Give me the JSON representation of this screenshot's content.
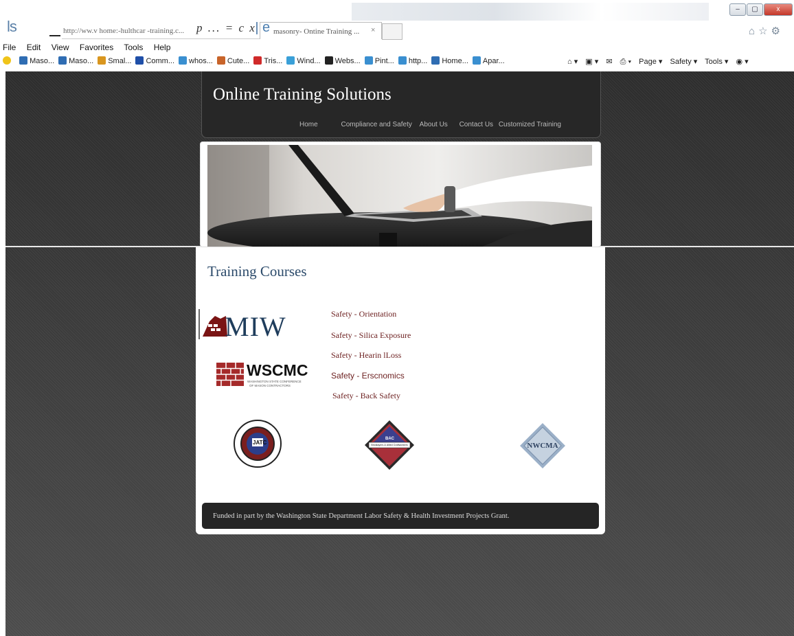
{
  "chrome": {
    "brand_letters": "ls",
    "url": "http://ww.v home:-hulthcar -training.c...",
    "address_controls": "p ... = c x",
    "tab_favicon_letter": "e",
    "tab_title": "masonry- Ontine Training ...",
    "tab_close": "×",
    "window_buttons": {
      "minimize": "–",
      "maximize": "▢",
      "close": "x"
    },
    "menu": [
      "File",
      "Edit",
      "View",
      "Favorites",
      "Tools",
      "Help"
    ],
    "favorites": [
      {
        "label": "Maso...",
        "icon": "blue-square-icon",
        "color": "#2f6db3"
      },
      {
        "label": "Maso...",
        "icon": "blue-square-icon",
        "color": "#2f6db3"
      },
      {
        "label": "Smal...",
        "icon": "leaf-icon",
        "color": "#d9961f"
      },
      {
        "label": "Comm...",
        "icon": "chart-icon",
        "color": "#1f4fa8"
      },
      {
        "label": "whos...",
        "icon": "ie-page-icon",
        "color": "#3a8fd0"
      },
      {
        "label": "Cute...",
        "icon": "feather-icon",
        "color": "#c8642a"
      },
      {
        "label": "Tris...",
        "icon": "red-circle-icon",
        "color": "#d02a2a"
      },
      {
        "label": "Wind...",
        "icon": "windows-icon",
        "color": "#3aa0d8"
      },
      {
        "label": "Webs...",
        "icon": "w-icon",
        "color": "#222222"
      },
      {
        "label": "Pint...",
        "icon": "ie-page-icon",
        "color": "#3a8fd0"
      },
      {
        "label": "http...",
        "icon": "ie-page-icon",
        "color": "#3a8fd0"
      },
      {
        "label": "Home...",
        "icon": "globe-icon",
        "color": "#2f6db3"
      },
      {
        "label": "Apar...",
        "icon": "ie-page-icon",
        "color": "#3a8fd0"
      }
    ],
    "command_bar": [
      "Page ▾",
      "Safety ▾",
      "Tools ▾"
    ]
  },
  "site": {
    "title": "Online Training Solutions",
    "nav": [
      "Home",
      "Compliance and Safety",
      "About Us",
      "Contact Us",
      "Customized Training"
    ]
  },
  "main": {
    "heading": "Training Courses",
    "courses": [
      "Safety  -  Orientation",
      "Safety  -  Silica Exposure",
      "Safety  -  Hearin lLoss",
      "Safety - Erscnomics",
      "Safety  -  Back Safety"
    ],
    "logos": {
      "miw": "MIW",
      "wscmc": "WSCMC",
      "wscmc_sub1": "WASHINGTON STATE CONFERENCE",
      "wscmc_sub2": "OF MASON CONTRACTORS",
      "jatc": "JATC",
      "bac_top": "BAC",
      "bac_mid": "Bricklayers & Allied Craftworkers",
      "nwcma": "NWCMA"
    }
  },
  "footer": {
    "text": "Funded in part by the Washington State Department Labor Safety & Health Investment Projects Grant."
  }
}
